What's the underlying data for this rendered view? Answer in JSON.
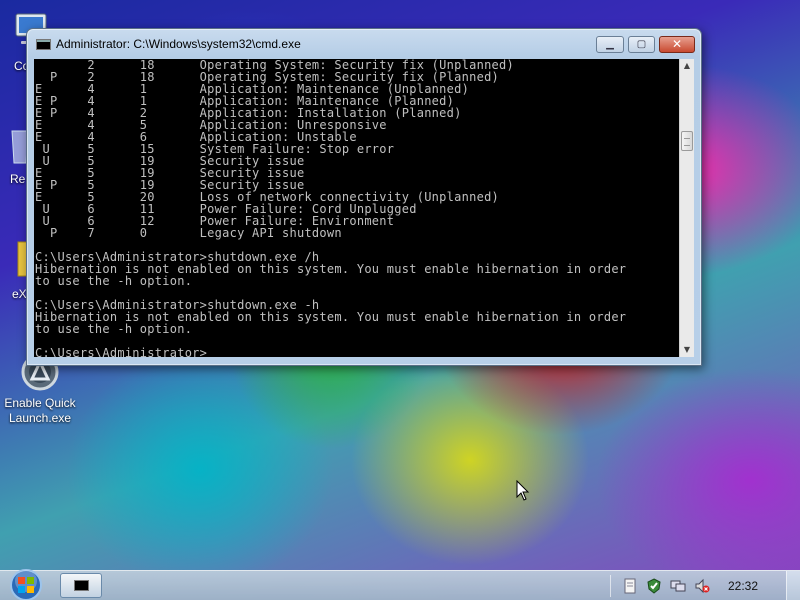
{
  "window": {
    "title": "Administrator: C:\\Windows\\system32\\cmd.exe",
    "minimize_icon": "minimize-icon",
    "maximize_icon": "maximize-icon",
    "close_icon": "close-icon"
  },
  "console": {
    "lines": [
      "       2      18      Operating System: Security fix (Unplanned)",
      "  P    2      18      Operating System: Security fix (Planned)",
      "E      4      1       Application: Maintenance (Unplanned)",
      "E P    4      1       Application: Maintenance (Planned)",
      "E P    4      2       Application: Installation (Planned)",
      "E      4      5       Application: Unresponsive",
      "E      4      6       Application: Unstable",
      " U     5      15      System Failure: Stop error",
      " U     5      19      Security issue",
      "E      5      19      Security issue",
      "E P    5      19      Security issue",
      "E      5      20      Loss of network connectivity (Unplanned)",
      " U     6      11      Power Failure: Cord Unplugged",
      " U     6      12      Power Failure: Environment",
      "  P    7      0       Legacy API shutdown",
      "",
      "C:\\Users\\Administrator>shutdown.exe /h",
      "Hibernation is not enabled on this system. You must enable hibernation in order",
      "to use the -h option.",
      "",
      "C:\\Users\\Administrator>shutdown.exe -h",
      "Hibernation is not enabled on this system. You must enable hibernation in order",
      "to use the -h option.",
      "",
      "C:\\Users\\Administrator>"
    ]
  },
  "desktop": {
    "icons": [
      {
        "label": "Co",
        "icon": "computer-icon"
      },
      {
        "label": "Re",
        "icon": "recycle-bin-icon"
      },
      {
        "label": "eX",
        "icon": "folder-icon"
      },
      {
        "label": "Enable Quick Launch.exe",
        "icon": "quick-launch-icon"
      }
    ]
  },
  "taskbar": {
    "start_icon": "windows-start-icon",
    "task_icon": "cmd-icon",
    "tray_icons": [
      "action-center-icon",
      "security-icon",
      "network-icon",
      "volume-muted-icon"
    ],
    "clock": "22:32"
  },
  "colors": {
    "console_bg": "#000000",
    "console_fg": "#c0c0c0",
    "window_frame": "#b7cfe8",
    "close_button": "#c84a30"
  }
}
